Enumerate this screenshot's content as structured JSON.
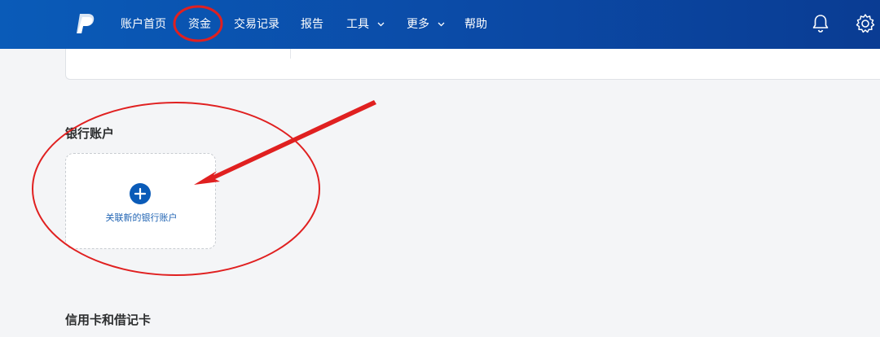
{
  "nav": {
    "items": [
      {
        "label": "账户首页"
      },
      {
        "label": "资金"
      },
      {
        "label": "交易记录"
      },
      {
        "label": "报告"
      },
      {
        "label": "工具"
      },
      {
        "label": "更多"
      },
      {
        "label": "帮助"
      }
    ]
  },
  "bank_section": {
    "title": "银行账户",
    "add_label": "关联新的银行账户"
  },
  "card_section": {
    "title": "信用卡和借记卡"
  },
  "colors": {
    "header": "#0a4aa6",
    "accent": "#0a5bb8",
    "annotation": "#e02020"
  },
  "icons": [
    "paypal-logo",
    "bell-icon",
    "gear-icon",
    "plus-icon",
    "chevron-down-icon"
  ]
}
